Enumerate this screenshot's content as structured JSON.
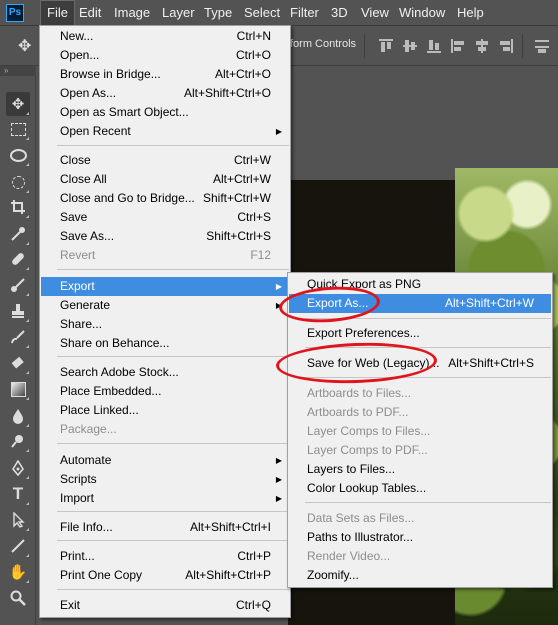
{
  "menubar": {
    "logo": "Ps",
    "items": [
      "File",
      "Edit",
      "Image",
      "Layer",
      "Type",
      "Select",
      "Filter",
      "3D",
      "View",
      "Window",
      "Help"
    ]
  },
  "options_bar": {
    "label": "form Controls"
  },
  "toolbar": {
    "collapse": "»",
    "tools": [
      "move-tool",
      "marquee-tool",
      "lasso-tool",
      "quick-select-tool",
      "crop-tool",
      "eyedropper-tool",
      "healing-brush-tool",
      "brush-tool",
      "clone-stamp-tool",
      "history-brush-tool",
      "eraser-tool",
      "gradient-tool",
      "blur-tool",
      "dodge-tool",
      "pen-tool",
      "type-tool",
      "path-select-tool",
      "line-tool",
      "hand-tool",
      "zoom-tool"
    ]
  },
  "file_menu": {
    "groups": [
      [
        {
          "label": "New...",
          "shortcut": "Ctrl+N"
        },
        {
          "label": "Open...",
          "shortcut": "Ctrl+O"
        },
        {
          "label": "Browse in Bridge...",
          "shortcut": "Alt+Ctrl+O"
        },
        {
          "label": "Open As...",
          "shortcut": "Alt+Shift+Ctrl+O"
        },
        {
          "label": "Open as Smart Object...",
          "shortcut": ""
        },
        {
          "label": "Open Recent",
          "shortcut": "",
          "submenu": true
        }
      ],
      [
        {
          "label": "Close",
          "shortcut": "Ctrl+W"
        },
        {
          "label": "Close All",
          "shortcut": "Alt+Ctrl+W"
        },
        {
          "label": "Close and Go to Bridge...",
          "shortcut": "Shift+Ctrl+W"
        },
        {
          "label": "Save",
          "shortcut": "Ctrl+S"
        },
        {
          "label": "Save As...",
          "shortcut": "Shift+Ctrl+S"
        },
        {
          "label": "Revert",
          "shortcut": "F12",
          "disabled": true
        }
      ],
      [
        {
          "label": "Export",
          "shortcut": "",
          "submenu": true,
          "highlighted": true
        },
        {
          "label": "Generate",
          "shortcut": "",
          "submenu": true
        },
        {
          "label": "Share...",
          "shortcut": ""
        },
        {
          "label": "Share on Behance...",
          "shortcut": ""
        }
      ],
      [
        {
          "label": "Search Adobe Stock...",
          "shortcut": ""
        },
        {
          "label": "Place Embedded...",
          "shortcut": ""
        },
        {
          "label": "Place Linked...",
          "shortcut": ""
        },
        {
          "label": "Package...",
          "shortcut": "",
          "disabled": true
        }
      ],
      [
        {
          "label": "Automate",
          "shortcut": "",
          "submenu": true
        },
        {
          "label": "Scripts",
          "shortcut": "",
          "submenu": true
        },
        {
          "label": "Import",
          "shortcut": "",
          "submenu": true
        }
      ],
      [
        {
          "label": "File Info...",
          "shortcut": "Alt+Shift+Ctrl+I"
        }
      ],
      [
        {
          "label": "Print...",
          "shortcut": "Ctrl+P"
        },
        {
          "label": "Print One Copy",
          "shortcut": "Alt+Shift+Ctrl+P"
        }
      ],
      [
        {
          "label": "Exit",
          "shortcut": "Ctrl+Q"
        }
      ]
    ]
  },
  "export_menu": {
    "groups": [
      [
        {
          "label": "Quick Export as PNG",
          "shortcut": ""
        },
        {
          "label": "Export As...",
          "shortcut": "Alt+Shift+Ctrl+W",
          "highlighted": true
        }
      ],
      [
        {
          "label": "Export Preferences...",
          "shortcut": ""
        }
      ],
      [
        {
          "label": "Save for Web (Legacy)...",
          "shortcut": "Alt+Shift+Ctrl+S"
        }
      ],
      [
        {
          "label": "Artboards to Files...",
          "shortcut": "",
          "disabled": true
        },
        {
          "label": "Artboards to PDF...",
          "shortcut": "",
          "disabled": true
        },
        {
          "label": "Layer Comps to Files...",
          "shortcut": "",
          "disabled": true
        },
        {
          "label": "Layer Comps to PDF...",
          "shortcut": "",
          "disabled": true
        },
        {
          "label": "Layers to Files...",
          "shortcut": ""
        },
        {
          "label": "Color Lookup Tables...",
          "shortcut": ""
        }
      ],
      [
        {
          "label": "Data Sets as Files...",
          "shortcut": "",
          "disabled": true
        },
        {
          "label": "Paths to Illustrator...",
          "shortcut": ""
        },
        {
          "label": "Render Video...",
          "shortcut": "",
          "disabled": true
        },
        {
          "label": "Zoomify...",
          "shortcut": ""
        }
      ]
    ]
  },
  "colors": {
    "highlight": "#3f8de0",
    "menu_bg": "#f0f0f0",
    "ui_bg": "#535353",
    "annotation": "#e0141c"
  }
}
